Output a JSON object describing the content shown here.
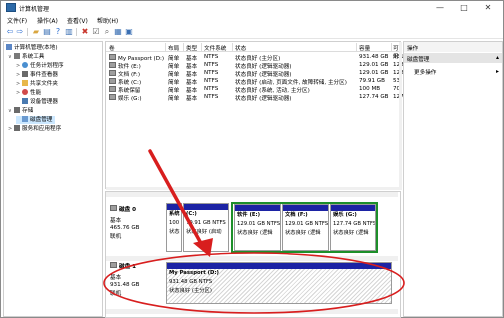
{
  "window": {
    "title": "计算机管理",
    "controls": [
      "—",
      "□",
      "✕"
    ]
  },
  "menu": [
    "文件(F)",
    "操作(A)",
    "查看(V)",
    "帮助(H)"
  ],
  "toolbar": {
    "icons": [
      "back-icon",
      "forward-icon",
      "up-folder-icon",
      "properties-icon",
      "help-icon",
      "show-hide-icon",
      "delete-icon",
      "properties-sheet-icon",
      "search-icon",
      "new-icon",
      "tree-icon"
    ]
  },
  "tree": [
    {
      "label": "计算机管理(本地)",
      "level": 0,
      "expander": "",
      "icon": "computer-icon",
      "color": "#5b86c5"
    },
    {
      "label": "系统工具",
      "level": 1,
      "expander": "∨",
      "icon": "tools-icon",
      "color": "#7a7a7a"
    },
    {
      "label": "任务计划程序",
      "level": 2,
      "expander": ">",
      "icon": "clock-icon",
      "color": "#4a8fd0"
    },
    {
      "label": "事件查看器",
      "level": 2,
      "expander": ">",
      "icon": "event-icon",
      "color": "#6a6a6a"
    },
    {
      "label": "共享文件夹",
      "level": 2,
      "expander": ">",
      "icon": "folder-icon",
      "color": "#e8b84a"
    },
    {
      "label": "性能",
      "level": 2,
      "expander": ">",
      "icon": "performance-icon",
      "color": "#d04a4a"
    },
    {
      "label": "设备管理器",
      "level": 2,
      "expander": "",
      "icon": "device-icon",
      "color": "#4a7ab0"
    },
    {
      "label": "存储",
      "level": 1,
      "expander": "∨",
      "icon": "storage-icon",
      "color": "#6a6a6a"
    },
    {
      "label": "磁盘管理",
      "level": 2,
      "expander": "",
      "icon": "disk-icon",
      "color": "#6a9ad0",
      "selected": true
    },
    {
      "label": "服务和应用程序",
      "level": 1,
      "expander": ">",
      "icon": "services-icon",
      "color": "#6a6a6a"
    }
  ],
  "volumes": {
    "headers": [
      "卷",
      "布局",
      "类型",
      "文件系统",
      "状态",
      "容量",
      "可用"
    ],
    "rows": [
      [
        "My Passport (D:)",
        "简单",
        "基本",
        "NTFS",
        "状态良好 (主分区)",
        "931.48 GB",
        "931"
      ],
      [
        "软件 (E:)",
        "简单",
        "基本",
        "NTFS",
        "状态良好 (逻辑驱动器)",
        "129.01 GB",
        "128"
      ],
      [
        "文档 (F:)",
        "简单",
        "基本",
        "NTFS",
        "状态良好 (逻辑驱动器)",
        "129.01 GB",
        "128"
      ],
      [
        "系统 (C:)",
        "简单",
        "基本",
        "NTFS",
        "状态良好 (启动, 页面文件, 故障转储, 主分区)",
        "79.91 GB",
        "53."
      ],
      [
        "系统保留",
        "简单",
        "基本",
        "NTFS",
        "状态良好 (系统, 活动, 主分区)",
        "100 MB",
        "70"
      ],
      [
        "娱乐 (G:)",
        "简单",
        "基本",
        "NTFS",
        "状态良好 (逻辑驱动器)",
        "127.74 GB",
        "127"
      ]
    ]
  },
  "disks": [
    {
      "name": "磁盘 0",
      "type": "基本",
      "size": "465.76 GB",
      "status": "联机",
      "partitions": [
        {
          "title": "系统",
          "size": "100",
          "status": "状态"
        },
        {
          "title": "(C:)",
          "size": "79.91 GB NTFS",
          "status": "状态良好 (启动"
        },
        {
          "title": "软件 (E:)",
          "size": "129.01 GB NTFS",
          "status": "状态良好 (逻辑"
        },
        {
          "title": "文档 (F:)",
          "size": "129.01 GB NTFS",
          "status": "状态良好 (逻辑"
        },
        {
          "title": "娱乐 (G:)",
          "size": "127.74 GB NTFS",
          "status": "状态良好 (逻辑"
        }
      ]
    },
    {
      "name": "磁盘 1",
      "type": "基本",
      "size": "931.48 GB",
      "status": "联机",
      "partitions": [
        {
          "title": "My Passport (D:)",
          "size": "931.48 GB NTFS",
          "status": "状态良好 (主分区)"
        }
      ]
    }
  ],
  "actions": {
    "header": "操作",
    "section": "磁盘管理",
    "more": "更多操作"
  },
  "colors": {
    "partition_bar": "#1c23a4",
    "extended_border": "#1d8f2a",
    "annotation": "#d81e1e",
    "selection": "#cce8ff"
  }
}
